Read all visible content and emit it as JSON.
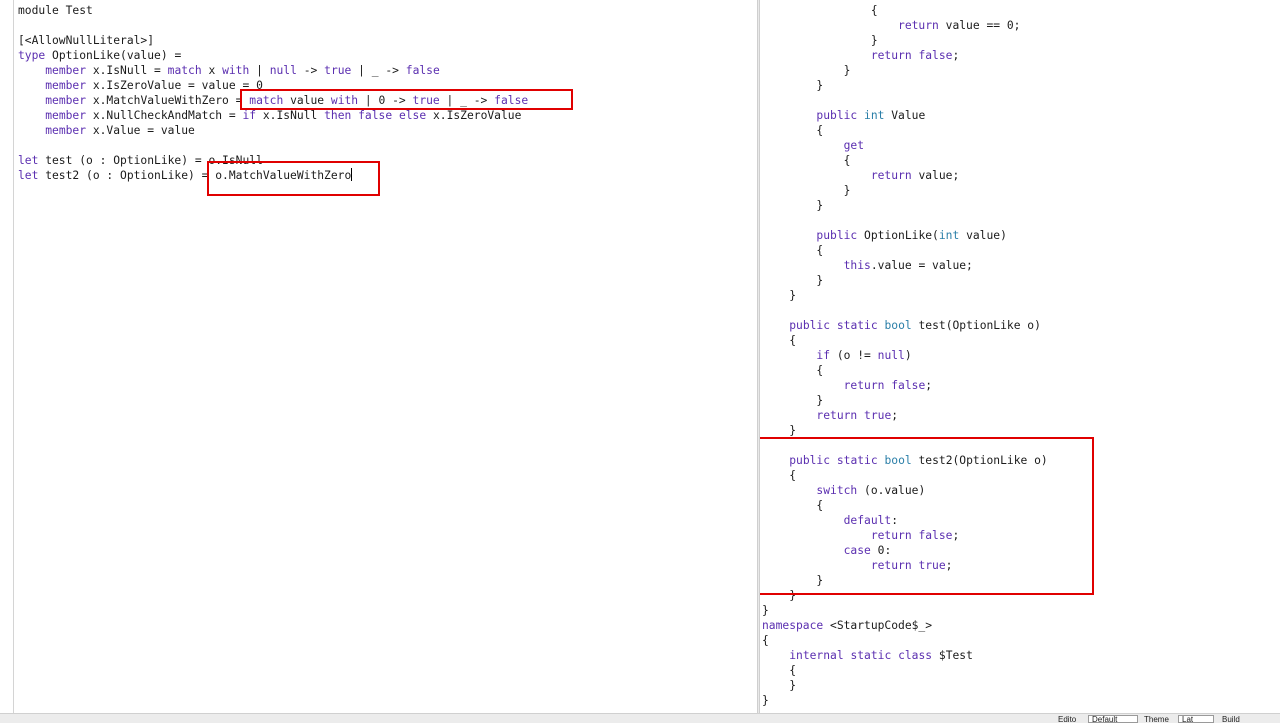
{
  "left_editor": {
    "lines": [
      [
        {
          "t": "module Test"
        }
      ],
      [],
      [
        {
          "t": "[<AllowNullLiteral>]"
        }
      ],
      [
        {
          "t": "type",
          "k": "kw"
        },
        {
          "t": " OptionLike(value) ="
        }
      ],
      [
        {
          "t": "    "
        },
        {
          "t": "member",
          "k": "kw"
        },
        {
          "t": " x.IsNull = "
        },
        {
          "t": "match",
          "k": "kw"
        },
        {
          "t": " x "
        },
        {
          "t": "with",
          "k": "kw"
        },
        {
          "t": " | "
        },
        {
          "t": "null",
          "k": "kw"
        },
        {
          "t": " -> "
        },
        {
          "t": "true",
          "k": "kw"
        },
        {
          "t": " | _ -> "
        },
        {
          "t": "false",
          "k": "kw"
        }
      ],
      [
        {
          "t": "    "
        },
        {
          "t": "member",
          "k": "kw"
        },
        {
          "t": " x.IsZeroValue = value = 0"
        }
      ],
      [
        {
          "t": "    "
        },
        {
          "t": "member",
          "k": "kw"
        },
        {
          "t": " x.MatchValueWithZero = "
        },
        {
          "t": "match",
          "k": "kw"
        },
        {
          "t": " value "
        },
        {
          "t": "with",
          "k": "kw"
        },
        {
          "t": " | 0 -> "
        },
        {
          "t": "true",
          "k": "kw"
        },
        {
          "t": " | _ -> "
        },
        {
          "t": "false",
          "k": "kw"
        }
      ],
      [
        {
          "t": "    "
        },
        {
          "t": "member",
          "k": "kw"
        },
        {
          "t": " x.NullCheckAndMatch = "
        },
        {
          "t": "if",
          "k": "kw"
        },
        {
          "t": " x.IsNull "
        },
        {
          "t": "then",
          "k": "kw"
        },
        {
          "t": " "
        },
        {
          "t": "false",
          "k": "kw"
        },
        {
          "t": " "
        },
        {
          "t": "else",
          "k": "kw"
        },
        {
          "t": " x.IsZeroValue"
        }
      ],
      [
        {
          "t": "    "
        },
        {
          "t": "member",
          "k": "kw"
        },
        {
          "t": " x.Value = value"
        }
      ],
      [],
      [
        {
          "t": "let",
          "k": "kw"
        },
        {
          "t": " test (o : OptionLike) = o.IsNull"
        }
      ],
      [
        {
          "t": "let",
          "k": "kw"
        },
        {
          "t": " test2 (o : OptionLike) = o.MatchValueWithZero"
        },
        {
          "caret": true
        }
      ]
    ]
  },
  "right_editor": {
    "lines": [
      [
        {
          "t": "                {"
        }
      ],
      [
        {
          "t": "                    "
        },
        {
          "t": "return",
          "k": "kw"
        },
        {
          "t": " value == 0;"
        }
      ],
      [
        {
          "t": "                }"
        }
      ],
      [
        {
          "t": "                "
        },
        {
          "t": "return",
          "k": "kw"
        },
        {
          "t": " "
        },
        {
          "t": "false",
          "k": "kw"
        },
        {
          "t": ";"
        }
      ],
      [
        {
          "t": "            }"
        }
      ],
      [
        {
          "t": "        }"
        }
      ],
      [],
      [
        {
          "t": "        "
        },
        {
          "t": "public",
          "k": "kw"
        },
        {
          "t": " "
        },
        {
          "t": "int",
          "k": "ty"
        },
        {
          "t": " Value"
        }
      ],
      [
        {
          "t": "        {"
        }
      ],
      [
        {
          "t": "            "
        },
        {
          "t": "get",
          "k": "kw"
        }
      ],
      [
        {
          "t": "            {"
        }
      ],
      [
        {
          "t": "                "
        },
        {
          "t": "return",
          "k": "kw"
        },
        {
          "t": " value;"
        }
      ],
      [
        {
          "t": "            }"
        }
      ],
      [
        {
          "t": "        }"
        }
      ],
      [],
      [
        {
          "t": "        "
        },
        {
          "t": "public",
          "k": "kw"
        },
        {
          "t": " OptionLike("
        },
        {
          "t": "int",
          "k": "ty"
        },
        {
          "t": " value)"
        }
      ],
      [
        {
          "t": "        {"
        }
      ],
      [
        {
          "t": "            "
        },
        {
          "t": "this",
          "k": "kw"
        },
        {
          "t": ".value = value;"
        }
      ],
      [
        {
          "t": "        }"
        }
      ],
      [
        {
          "t": "    }"
        }
      ],
      [],
      [
        {
          "t": "    "
        },
        {
          "t": "public",
          "k": "kw"
        },
        {
          "t": " "
        },
        {
          "t": "static",
          "k": "kw"
        },
        {
          "t": " "
        },
        {
          "t": "bool",
          "k": "ty"
        },
        {
          "t": " test(OptionLike o)"
        }
      ],
      [
        {
          "t": "    {"
        }
      ],
      [
        {
          "t": "        "
        },
        {
          "t": "if",
          "k": "kw"
        },
        {
          "t": " (o != "
        },
        {
          "t": "null",
          "k": "kw"
        },
        {
          "t": ")"
        }
      ],
      [
        {
          "t": "        {"
        }
      ],
      [
        {
          "t": "            "
        },
        {
          "t": "return",
          "k": "kw"
        },
        {
          "t": " "
        },
        {
          "t": "false",
          "k": "kw"
        },
        {
          "t": ";"
        }
      ],
      [
        {
          "t": "        }"
        }
      ],
      [
        {
          "t": "        "
        },
        {
          "t": "return",
          "k": "kw"
        },
        {
          "t": " "
        },
        {
          "t": "true",
          "k": "kw"
        },
        {
          "t": ";"
        }
      ],
      [
        {
          "t": "    }"
        }
      ],
      [],
      [
        {
          "t": "    "
        },
        {
          "t": "public",
          "k": "kw"
        },
        {
          "t": " "
        },
        {
          "t": "static",
          "k": "kw"
        },
        {
          "t": " "
        },
        {
          "t": "bool",
          "k": "ty"
        },
        {
          "t": " test2(OptionLike o)"
        }
      ],
      [
        {
          "t": "    {"
        }
      ],
      [
        {
          "t": "        "
        },
        {
          "t": "switch",
          "k": "kw"
        },
        {
          "t": " (o.value)"
        }
      ],
      [
        {
          "t": "        {"
        }
      ],
      [
        {
          "t": "            "
        },
        {
          "t": "default",
          "k": "kw"
        },
        {
          "t": ":"
        }
      ],
      [
        {
          "t": "                "
        },
        {
          "t": "return",
          "k": "kw"
        },
        {
          "t": " "
        },
        {
          "t": "false",
          "k": "kw"
        },
        {
          "t": ";"
        }
      ],
      [
        {
          "t": "            "
        },
        {
          "t": "case",
          "k": "kw"
        },
        {
          "t": " 0:"
        }
      ],
      [
        {
          "t": "                "
        },
        {
          "t": "return",
          "k": "kw"
        },
        {
          "t": " "
        },
        {
          "t": "true",
          "k": "kw"
        },
        {
          "t": ";"
        }
      ],
      [
        {
          "t": "        }"
        }
      ],
      [
        {
          "t": "    }"
        }
      ],
      [
        {
          "t": "}"
        }
      ],
      [
        {
          "t": "namespace",
          "k": "kw"
        },
        {
          "t": " <StartupCode$_>"
        }
      ],
      [
        {
          "t": "{"
        }
      ],
      [
        {
          "t": "    "
        },
        {
          "t": "internal",
          "k": "kw"
        },
        {
          "t": " "
        },
        {
          "t": "static",
          "k": "kw"
        },
        {
          "t": " "
        },
        {
          "t": "class",
          "k": "kw"
        },
        {
          "t": " $Test"
        }
      ],
      [
        {
          "t": "    {"
        }
      ],
      [
        {
          "t": "    }"
        }
      ],
      [
        {
          "t": "}"
        }
      ]
    ]
  },
  "colors": {
    "keyword": "#5b2fb0",
    "type": "#2b7fa8",
    "text": "#1b1b1b",
    "highlight_box": "#e00000"
  },
  "status_bar": {
    "editor_label": "Edito",
    "editor_value": "Default",
    "theme_label": "Theme",
    "theme_value": "Lat",
    "build_label": "Build"
  }
}
